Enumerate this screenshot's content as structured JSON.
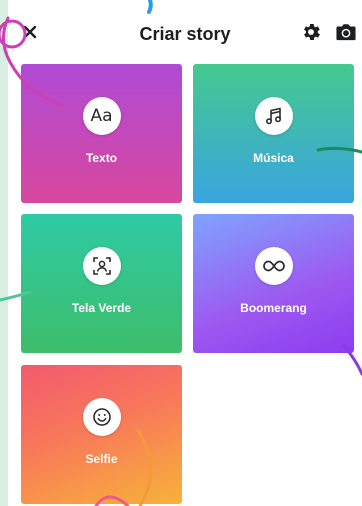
{
  "header": {
    "title": "Criar story",
    "close_icon": "close-icon",
    "settings_icon": "gear-icon",
    "camera_icon": "camera-icon"
  },
  "tiles": [
    {
      "label": "Texto",
      "icon": "text-aa-icon",
      "glyph": "Aa"
    },
    {
      "label": "Música",
      "icon": "music-note-icon"
    },
    {
      "label": "Tela Verde",
      "icon": "green-screen-icon"
    },
    {
      "label": "Boomerang",
      "icon": "infinity-icon"
    },
    {
      "label": "Selfie",
      "icon": "smiley-face-icon"
    }
  ],
  "colors": {
    "texto": [
      "#b04bd6",
      "#d7479d"
    ],
    "musica": [
      "#45c98f",
      "#3aa4e0"
    ],
    "tela_verde": [
      "#2fcaa6",
      "#3ebd6a"
    ],
    "boomerang": [
      "#7fa4ff",
      "#9d58f0"
    ],
    "selfie": [
      "#f25a6e",
      "#f7b23a"
    ]
  }
}
